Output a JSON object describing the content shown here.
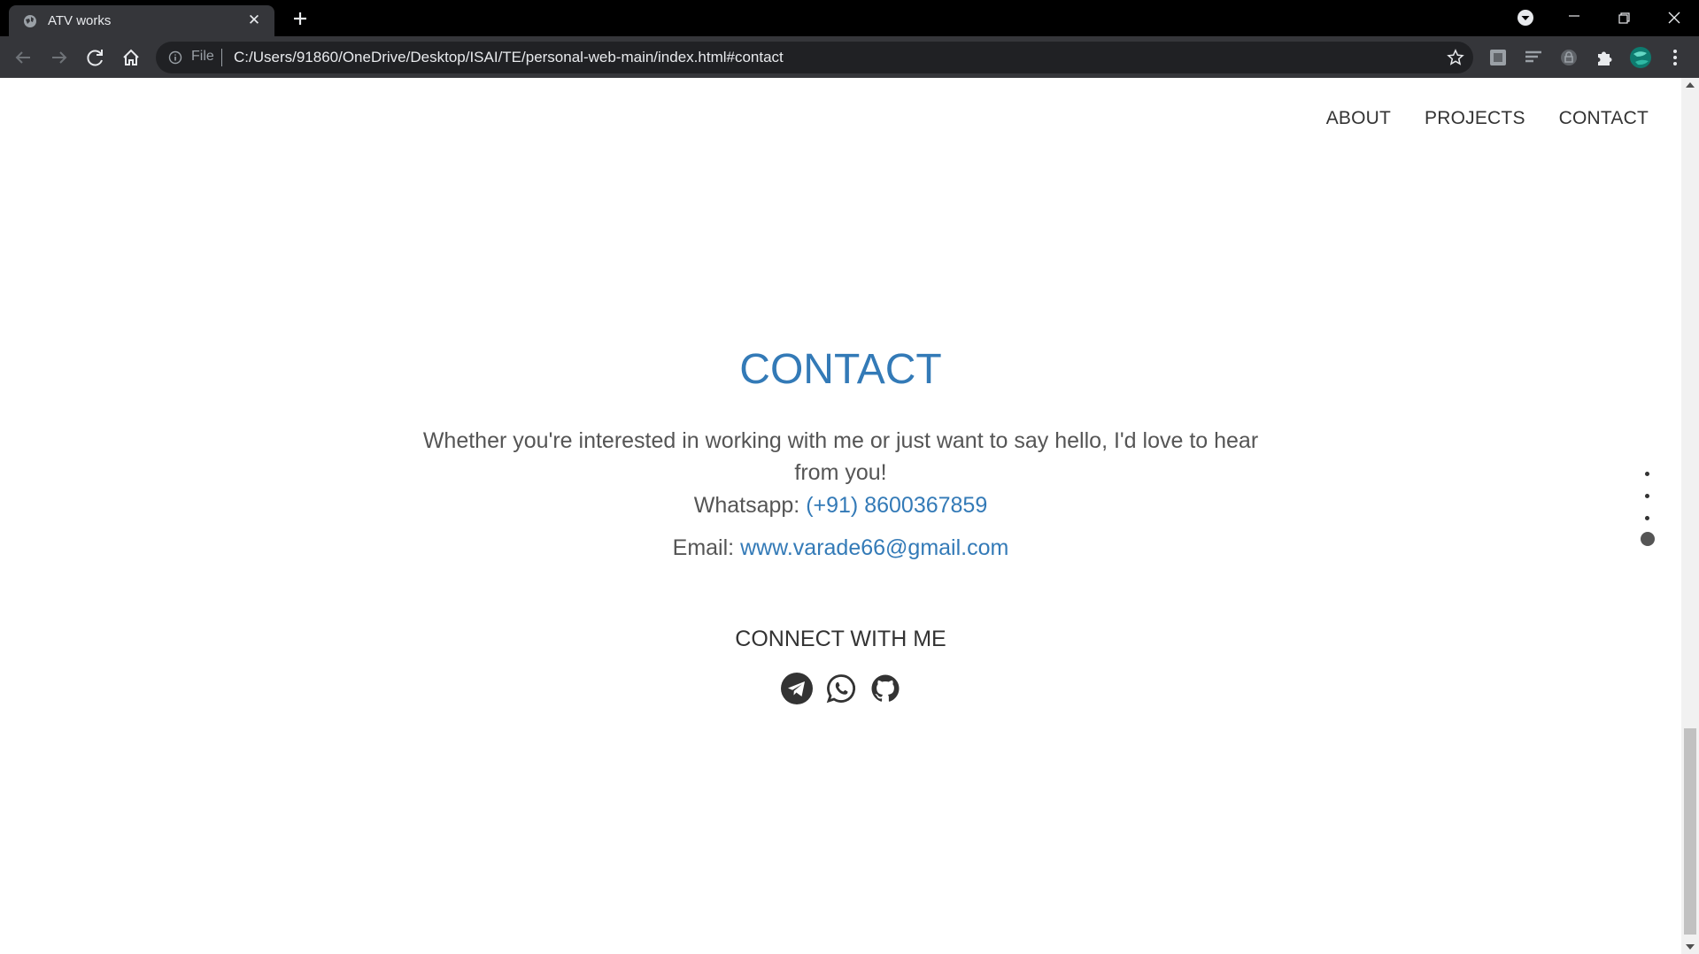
{
  "browser": {
    "tab_title": "ATV works",
    "address_prefix": "File",
    "url": "C:/Users/91860/OneDrive/Desktop/ISAI/TE/personal-web-main/index.html#contact"
  },
  "nav": {
    "items": [
      "ABOUT",
      "PROJECTS",
      "CONTACT"
    ]
  },
  "contact": {
    "heading": "CONTACT",
    "intro": "Whether you're interested in working with me or just want to say hello, I'd love to hear from you!",
    "whatsapp_label": "Whatsapp: ",
    "whatsapp_value": "(+91) 8600367859",
    "email_label": "Email: ",
    "email_value": "www.varade66@gmail.com",
    "connect_heading": "CONNECT WITH ME"
  },
  "social_icons": [
    "telegram-icon",
    "whatsapp-icon",
    "github-icon"
  ],
  "section_dots": {
    "count": 4,
    "active_index": 3
  },
  "colors": {
    "accent": "#337ab7",
    "text": "#555555",
    "chrome_dark": "#35363a"
  }
}
